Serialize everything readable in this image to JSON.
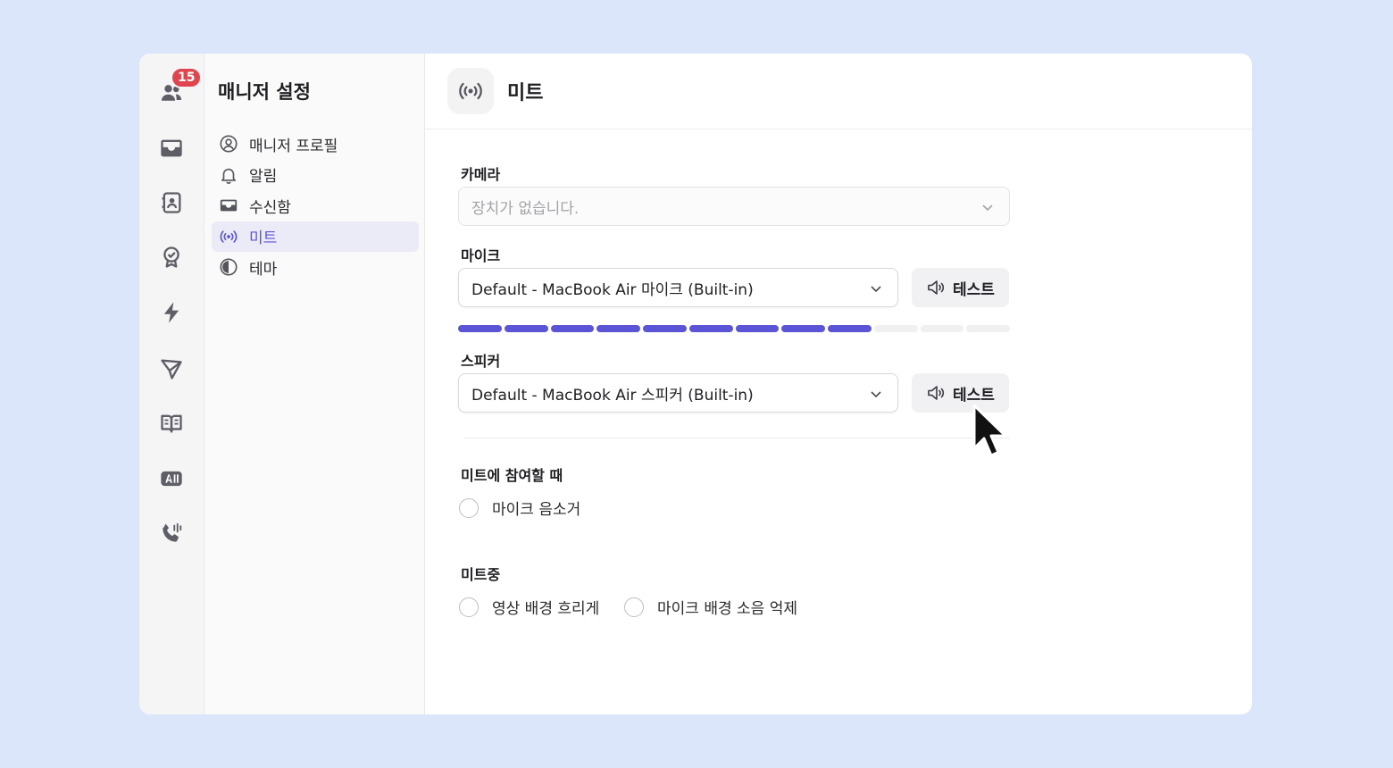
{
  "rail": {
    "badge_count": "15",
    "items": [
      {
        "icon": "users-icon"
      },
      {
        "icon": "inbox-icon"
      },
      {
        "icon": "contacts-icon"
      },
      {
        "icon": "badge-icon"
      },
      {
        "icon": "bolt-icon"
      },
      {
        "icon": "send-icon"
      },
      {
        "icon": "book-icon"
      },
      {
        "icon": "ai-icon"
      },
      {
        "icon": "phone-icon"
      }
    ]
  },
  "sidebar": {
    "title": "매니저 설정",
    "items": [
      {
        "label": "매니저 프로필",
        "icon": "user-circle-icon"
      },
      {
        "label": "알림",
        "icon": "bell-icon"
      },
      {
        "label": "수신함",
        "icon": "inbox-icon"
      },
      {
        "label": "미트",
        "icon": "broadcast-icon",
        "active": true
      },
      {
        "label": "테마",
        "icon": "theme-icon"
      }
    ]
  },
  "header": {
    "title": "미트",
    "icon": "broadcast-icon"
  },
  "camera": {
    "label": "카메라",
    "placeholder": "장치가 없습니다."
  },
  "mic": {
    "label": "마이크",
    "value": "Default - MacBook Air 마이크 (Built-in)",
    "test_label": "테스트",
    "level": {
      "active_segments": 9,
      "total_segments": 12
    }
  },
  "speaker": {
    "label": "스피커",
    "value": "Default - MacBook Air 스피커 (Built-in)",
    "test_label": "테스트"
  },
  "join": {
    "label": "미트에 참여할 때",
    "options": [
      {
        "label": "마이크 음소거",
        "checked": false
      }
    ]
  },
  "during": {
    "label": "미트중",
    "options": [
      {
        "label": "영상 배경 흐리게",
        "checked": false
      },
      {
        "label": "마이크 배경 소음 억제",
        "checked": false
      }
    ]
  },
  "colors": {
    "accent": "#5b54d6",
    "badge": "#e0454f",
    "background": "#dbe6fb"
  }
}
